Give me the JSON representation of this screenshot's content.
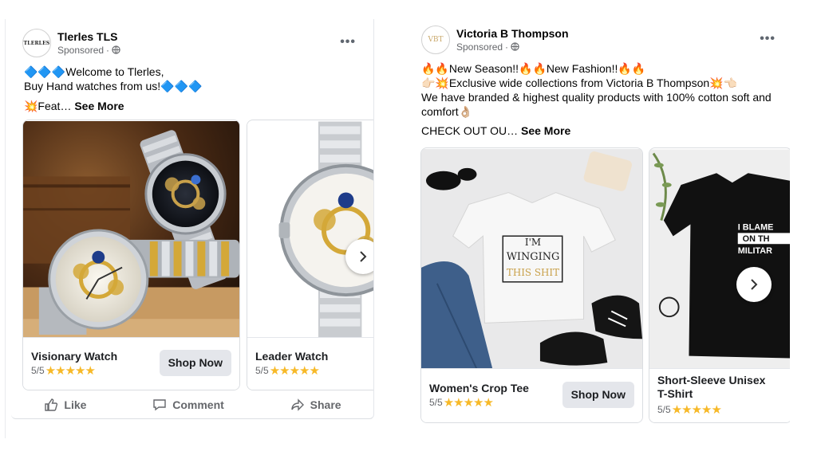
{
  "posts": [
    {
      "page_name": "Tlerles TLS",
      "avatar_text": "TLERLES",
      "sponsored": "Sponsored",
      "line1": "🔷🔷🔷Welcome to Tlerles,",
      "line2": "Buy  Hand watches from us!🔷🔷🔷",
      "line3": "💥Feat…",
      "see_more": "See More",
      "cards": [
        {
          "title": "Visionary Watch",
          "rating": "5/5",
          "stars": "★★★★★",
          "cta": "Shop Now"
        },
        {
          "title": "Leader Watch",
          "rating": "5/5",
          "stars": "★★★★★"
        }
      ],
      "actions": {
        "like": "Like",
        "comment": "Comment",
        "share": "Share"
      }
    },
    {
      "page_name": "Victoria B Thompson",
      "avatar_text": "VBT",
      "sponsored": "Sponsored",
      "line1": "🔥🔥New Season!!🔥🔥New Fashion!!🔥🔥",
      "line2": "👉🏻💥Exclusive wide collections from Victoria B Thompson💥👈🏻",
      "line3": "We have branded & highest quality products with 100% cotton soft and",
      "line4": "comfort👌🏼",
      "line5": "CHECK OUT OU…",
      "see_more": "See More",
      "cards": [
        {
          "title": "Women's Crop Tee",
          "rating": "5/5",
          "stars": "★★★★★",
          "cta": "Shop Now",
          "shirt_text_1": "I'M",
          "shirt_text_2": "WINGING",
          "shirt_text_3": "THIS SHIT"
        },
        {
          "title": "Short-Sleeve Unisex",
          "title2": "T-Shirt",
          "rating": "5/5",
          "stars": "★★★★★",
          "shirt_text_1": "I BLAME",
          "shirt_text_2": "ON TH",
          "shirt_text_3": "MILITAR"
        }
      ]
    }
  ],
  "colors": {
    "star": "#f7b928",
    "button_bg": "#e4e6eb",
    "muted": "#65676b"
  }
}
